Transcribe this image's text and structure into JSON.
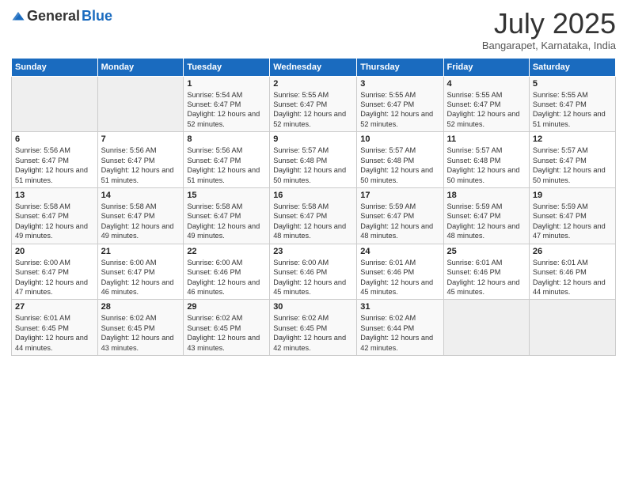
{
  "logo": {
    "general": "General",
    "blue": "Blue"
  },
  "title": {
    "month_year": "July 2025",
    "location": "Bangarapet, Karnataka, India"
  },
  "days_of_week": [
    "Sunday",
    "Monday",
    "Tuesday",
    "Wednesday",
    "Thursday",
    "Friday",
    "Saturday"
  ],
  "weeks": [
    [
      {
        "day": "",
        "info": ""
      },
      {
        "day": "",
        "info": ""
      },
      {
        "day": "1",
        "info": "Sunrise: 5:54 AM\nSunset: 6:47 PM\nDaylight: 12 hours and 52 minutes."
      },
      {
        "day": "2",
        "info": "Sunrise: 5:55 AM\nSunset: 6:47 PM\nDaylight: 12 hours and 52 minutes."
      },
      {
        "day": "3",
        "info": "Sunrise: 5:55 AM\nSunset: 6:47 PM\nDaylight: 12 hours and 52 minutes."
      },
      {
        "day": "4",
        "info": "Sunrise: 5:55 AM\nSunset: 6:47 PM\nDaylight: 12 hours and 52 minutes."
      },
      {
        "day": "5",
        "info": "Sunrise: 5:55 AM\nSunset: 6:47 PM\nDaylight: 12 hours and 51 minutes."
      }
    ],
    [
      {
        "day": "6",
        "info": "Sunrise: 5:56 AM\nSunset: 6:47 PM\nDaylight: 12 hours and 51 minutes."
      },
      {
        "day": "7",
        "info": "Sunrise: 5:56 AM\nSunset: 6:47 PM\nDaylight: 12 hours and 51 minutes."
      },
      {
        "day": "8",
        "info": "Sunrise: 5:56 AM\nSunset: 6:47 PM\nDaylight: 12 hours and 51 minutes."
      },
      {
        "day": "9",
        "info": "Sunrise: 5:57 AM\nSunset: 6:48 PM\nDaylight: 12 hours and 50 minutes."
      },
      {
        "day": "10",
        "info": "Sunrise: 5:57 AM\nSunset: 6:48 PM\nDaylight: 12 hours and 50 minutes."
      },
      {
        "day": "11",
        "info": "Sunrise: 5:57 AM\nSunset: 6:48 PM\nDaylight: 12 hours and 50 minutes."
      },
      {
        "day": "12",
        "info": "Sunrise: 5:57 AM\nSunset: 6:47 PM\nDaylight: 12 hours and 50 minutes."
      }
    ],
    [
      {
        "day": "13",
        "info": "Sunrise: 5:58 AM\nSunset: 6:47 PM\nDaylight: 12 hours and 49 minutes."
      },
      {
        "day": "14",
        "info": "Sunrise: 5:58 AM\nSunset: 6:47 PM\nDaylight: 12 hours and 49 minutes."
      },
      {
        "day": "15",
        "info": "Sunrise: 5:58 AM\nSunset: 6:47 PM\nDaylight: 12 hours and 49 minutes."
      },
      {
        "day": "16",
        "info": "Sunrise: 5:58 AM\nSunset: 6:47 PM\nDaylight: 12 hours and 48 minutes."
      },
      {
        "day": "17",
        "info": "Sunrise: 5:59 AM\nSunset: 6:47 PM\nDaylight: 12 hours and 48 minutes."
      },
      {
        "day": "18",
        "info": "Sunrise: 5:59 AM\nSunset: 6:47 PM\nDaylight: 12 hours and 48 minutes."
      },
      {
        "day": "19",
        "info": "Sunrise: 5:59 AM\nSunset: 6:47 PM\nDaylight: 12 hours and 47 minutes."
      }
    ],
    [
      {
        "day": "20",
        "info": "Sunrise: 6:00 AM\nSunset: 6:47 PM\nDaylight: 12 hours and 47 minutes."
      },
      {
        "day": "21",
        "info": "Sunrise: 6:00 AM\nSunset: 6:47 PM\nDaylight: 12 hours and 46 minutes."
      },
      {
        "day": "22",
        "info": "Sunrise: 6:00 AM\nSunset: 6:46 PM\nDaylight: 12 hours and 46 minutes."
      },
      {
        "day": "23",
        "info": "Sunrise: 6:00 AM\nSunset: 6:46 PM\nDaylight: 12 hours and 45 minutes."
      },
      {
        "day": "24",
        "info": "Sunrise: 6:01 AM\nSunset: 6:46 PM\nDaylight: 12 hours and 45 minutes."
      },
      {
        "day": "25",
        "info": "Sunrise: 6:01 AM\nSunset: 6:46 PM\nDaylight: 12 hours and 45 minutes."
      },
      {
        "day": "26",
        "info": "Sunrise: 6:01 AM\nSunset: 6:46 PM\nDaylight: 12 hours and 44 minutes."
      }
    ],
    [
      {
        "day": "27",
        "info": "Sunrise: 6:01 AM\nSunset: 6:45 PM\nDaylight: 12 hours and 44 minutes."
      },
      {
        "day": "28",
        "info": "Sunrise: 6:02 AM\nSunset: 6:45 PM\nDaylight: 12 hours and 43 minutes."
      },
      {
        "day": "29",
        "info": "Sunrise: 6:02 AM\nSunset: 6:45 PM\nDaylight: 12 hours and 43 minutes."
      },
      {
        "day": "30",
        "info": "Sunrise: 6:02 AM\nSunset: 6:45 PM\nDaylight: 12 hours and 42 minutes."
      },
      {
        "day": "31",
        "info": "Sunrise: 6:02 AM\nSunset: 6:44 PM\nDaylight: 12 hours and 42 minutes."
      },
      {
        "day": "",
        "info": ""
      },
      {
        "day": "",
        "info": ""
      }
    ]
  ]
}
